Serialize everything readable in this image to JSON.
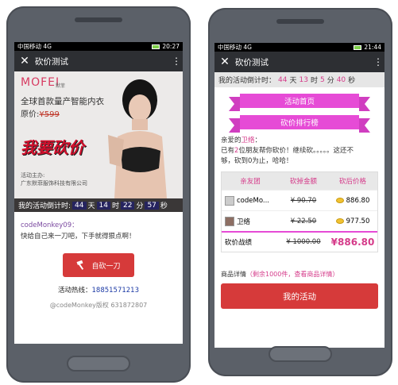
{
  "left": {
    "status": {
      "carrier": "中国移动 4G",
      "time": "20:27",
      "battery": "20"
    },
    "appbar": {
      "close": "✕",
      "title": "砍价测试",
      "more": "⋮"
    },
    "hero": {
      "logo": "MOFEI",
      "logo_sub": "默菲",
      "tagline": "全球首款量产智能内衣",
      "price_label": "原价:",
      "price_value": "¥599",
      "big_text": "我要砍价",
      "sponsor_label": "活动主办:",
      "sponsor_name": "广东默菲服饰科技有限公司"
    },
    "countdown": {
      "label": "我的活动倒计时:",
      "days": "44",
      "d_unit": "天",
      "hours": "14",
      "h_unit": "时",
      "mins": "22",
      "m_unit": "分",
      "secs": "57",
      "s_unit": "秒"
    },
    "user": "codeMonkey09：",
    "message": "快给自己来一刀吧，下手就得狠点啊！",
    "cut_button": "自砍一刀",
    "hotline_label": "活动热线：",
    "hotline_number": "18851571213",
    "copyright": "@codeMonkey版权 631872807"
  },
  "right": {
    "status": {
      "carrier": "中国移动 4G",
      "time": "21:44"
    },
    "appbar": {
      "close": "✕",
      "title": "砍价测试",
      "more": "⋮"
    },
    "countdown": {
      "label": "我的活动倒计时：",
      "days": "44",
      "d_unit": "天",
      "hours": "13",
      "h_unit": "时",
      "mins": "5",
      "m_unit": "分",
      "secs": "40",
      "s_unit": "秒"
    },
    "ribbon1": "活动首页",
    "ribbon2": "砍价排行榜",
    "greet_prefix": "亲爱的",
    "greet_name": "卫络",
    "greet_suffix": "：",
    "line2_a": "已有",
    "line2_n": "2",
    "line2_b": "位朋友帮你砍价！继续砍。。。。。这还不",
    "line3": "够，砍到0为止，哈哈！",
    "table": {
      "headers": [
        "亲友团",
        "砍掉金额",
        "砍后价格"
      ],
      "rows": [
        {
          "name": "codeMo...",
          "cut": "¥ 90.70",
          "after": "886.80"
        },
        {
          "name": "卫络",
          "cut": "¥ 22.50",
          "after": "977.50"
        }
      ],
      "total_label": "砍价战绩",
      "total_cut": "¥ 1000.00",
      "total_after": "¥886.80"
    },
    "detail_label": "商品详情",
    "detail_link": "（剩余1000件，查看商品详情）",
    "my_button": "我的活动"
  }
}
